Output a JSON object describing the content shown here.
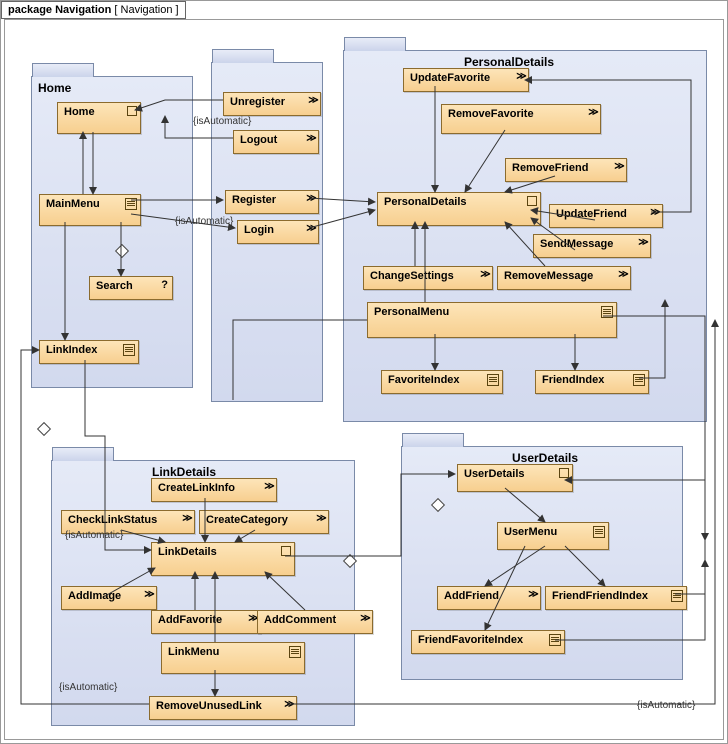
{
  "package": {
    "keyword": "package",
    "name": "Navigation",
    "bracket": "[ Navigation ]"
  },
  "groups": {
    "home": {
      "title": "Home"
    },
    "personal": {
      "title": "PersonalDetails"
    },
    "linkDetails": {
      "title": "LinkDetails"
    },
    "userDetails": {
      "title": "UserDetails"
    },
    "middle": {
      "title": ""
    }
  },
  "nodes": {
    "home_home": {
      "label": "Home"
    },
    "home_mainmenu": {
      "label": "MainMenu"
    },
    "home_search": {
      "label": "Search"
    },
    "home_linkindex": {
      "label": "LinkIndex"
    },
    "mid_unregister": {
      "label": "Unregister"
    },
    "mid_logout": {
      "label": "Logout"
    },
    "mid_register": {
      "label": "Register"
    },
    "mid_login": {
      "label": "Login"
    },
    "pd_updatefav": {
      "label": "UpdateFavorite"
    },
    "pd_removefav": {
      "label": "RemoveFavorite"
    },
    "pd_removefriend": {
      "label": "RemoveFriend"
    },
    "pd_updatefriend": {
      "label": "UpdateFriend"
    },
    "pd_sendmsg": {
      "label": "SendMessage"
    },
    "pd_details": {
      "label": "PersonalDetails"
    },
    "pd_changeset": {
      "label": "ChangeSettings"
    },
    "pd_removemsg": {
      "label": "RemoveMessage"
    },
    "pd_menu": {
      "label": "PersonalMenu"
    },
    "pd_favindex": {
      "label": "FavoriteIndex"
    },
    "pd_friendindex": {
      "label": "FriendIndex"
    },
    "ld_createlinkinfo": {
      "label": "CreateLinkInfo"
    },
    "ld_checkstatus": {
      "label": "CheckLinkStatus"
    },
    "ld_createcat": {
      "label": "CreateCategory"
    },
    "ld_linkdetails": {
      "label": "LinkDetails"
    },
    "ld_addimage": {
      "label": "AddImage"
    },
    "ld_addfav": {
      "label": "AddFavorite"
    },
    "ld_addcomment": {
      "label": "AddComment"
    },
    "ld_linkmenu": {
      "label": "LinkMenu"
    },
    "ld_removeunused": {
      "label": "RemoveUnusedLink"
    },
    "ud_userdetails": {
      "label": "UserDetails"
    },
    "ud_usermenu": {
      "label": "UserMenu"
    },
    "ud_addfriend": {
      "label": "AddFriend"
    },
    "ud_ffindex": {
      "label": "FriendFriendIndex"
    },
    "ud_ffavindex": {
      "label": "FriendFavoriteIndex"
    }
  },
  "annotations": {
    "a1": "{isAutomatic}",
    "a2": "{isAutomatic}",
    "a3": "{isAutomatic}",
    "a4": "{isAutomatic}",
    "a5": "{isAutomatic}"
  }
}
